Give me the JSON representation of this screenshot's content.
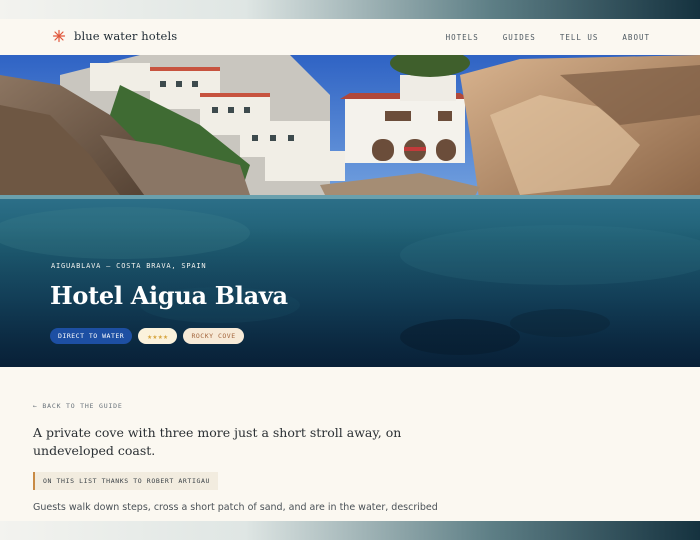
{
  "brand": {
    "name": "blue water hotels",
    "icon": "starburst-icon",
    "accent": "#e0553a"
  },
  "nav": {
    "links": [
      "HOTELS",
      "GUIDES",
      "TELL US",
      "ABOUT"
    ]
  },
  "hero": {
    "eyebrow": "AIGUABLAVA — COSTA BRAVA, SPAIN",
    "title": "Hotel Aigua Blava",
    "badges": {
      "water": "DIRECT TO WATER",
      "stars": "★★★★",
      "cove": "ROCKY COVE"
    }
  },
  "content": {
    "back_link": "← BACK TO THE GUIDE",
    "lead": "A private cove with three more just a short stroll away, on undeveloped coast.",
    "credit": "ON THIS LIST THANKS TO ROBERT ARTIGAU",
    "body": "Guests walk down steps, cross a short patch of sand, and are in the water, described"
  },
  "colors": {
    "badge_blue": "#1d4fa3",
    "background": "#fbf8f1"
  }
}
